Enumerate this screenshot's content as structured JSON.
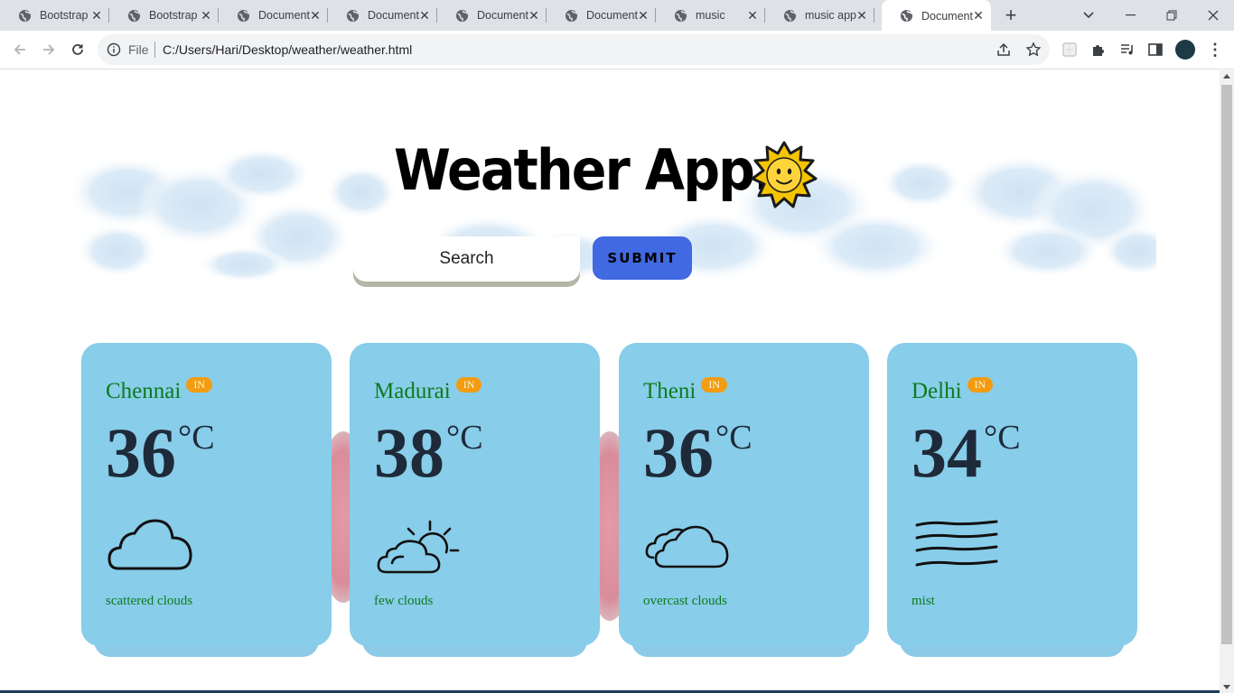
{
  "browser": {
    "tabs": [
      {
        "label": "Bootstrap",
        "active": false
      },
      {
        "label": "Bootstrap",
        "active": false
      },
      {
        "label": "Document",
        "active": false
      },
      {
        "label": "Document",
        "active": false
      },
      {
        "label": "Document",
        "active": false
      },
      {
        "label": "Document",
        "active": false
      },
      {
        "label": "music",
        "active": false
      },
      {
        "label": "music app",
        "active": false
      },
      {
        "label": "Document",
        "active": true
      }
    ],
    "address": {
      "scheme": "File",
      "url": "C:/Users/Hari/Desktop/weather/weather.html"
    }
  },
  "page": {
    "title": "Weather App...",
    "search": {
      "placeholder": "Search",
      "value": ""
    },
    "submit_label": "SUBMIT",
    "cards": [
      {
        "city": "Chennai",
        "country": "IN",
        "temp": "36",
        "unit": "°C",
        "icon": "cloud-icon",
        "desc": "scattered clouds"
      },
      {
        "city": "Madurai",
        "country": "IN",
        "temp": "38",
        "unit": "°C",
        "icon": "sun-cloud-icon",
        "desc": "few clouds"
      },
      {
        "city": "Theni",
        "country": "IN",
        "temp": "36",
        "unit": "°C",
        "icon": "overcast-clouds-icon",
        "desc": "overcast clouds"
      },
      {
        "city": "Delhi",
        "country": "IN",
        "temp": "34",
        "unit": "°C",
        "icon": "mist-icon",
        "desc": "mist"
      }
    ]
  },
  "colors": {
    "card_bg": "#88cde9",
    "submit_bg": "#4169e1",
    "city_text": "#0d7a1e",
    "badge_bg": "#f39c12"
  }
}
